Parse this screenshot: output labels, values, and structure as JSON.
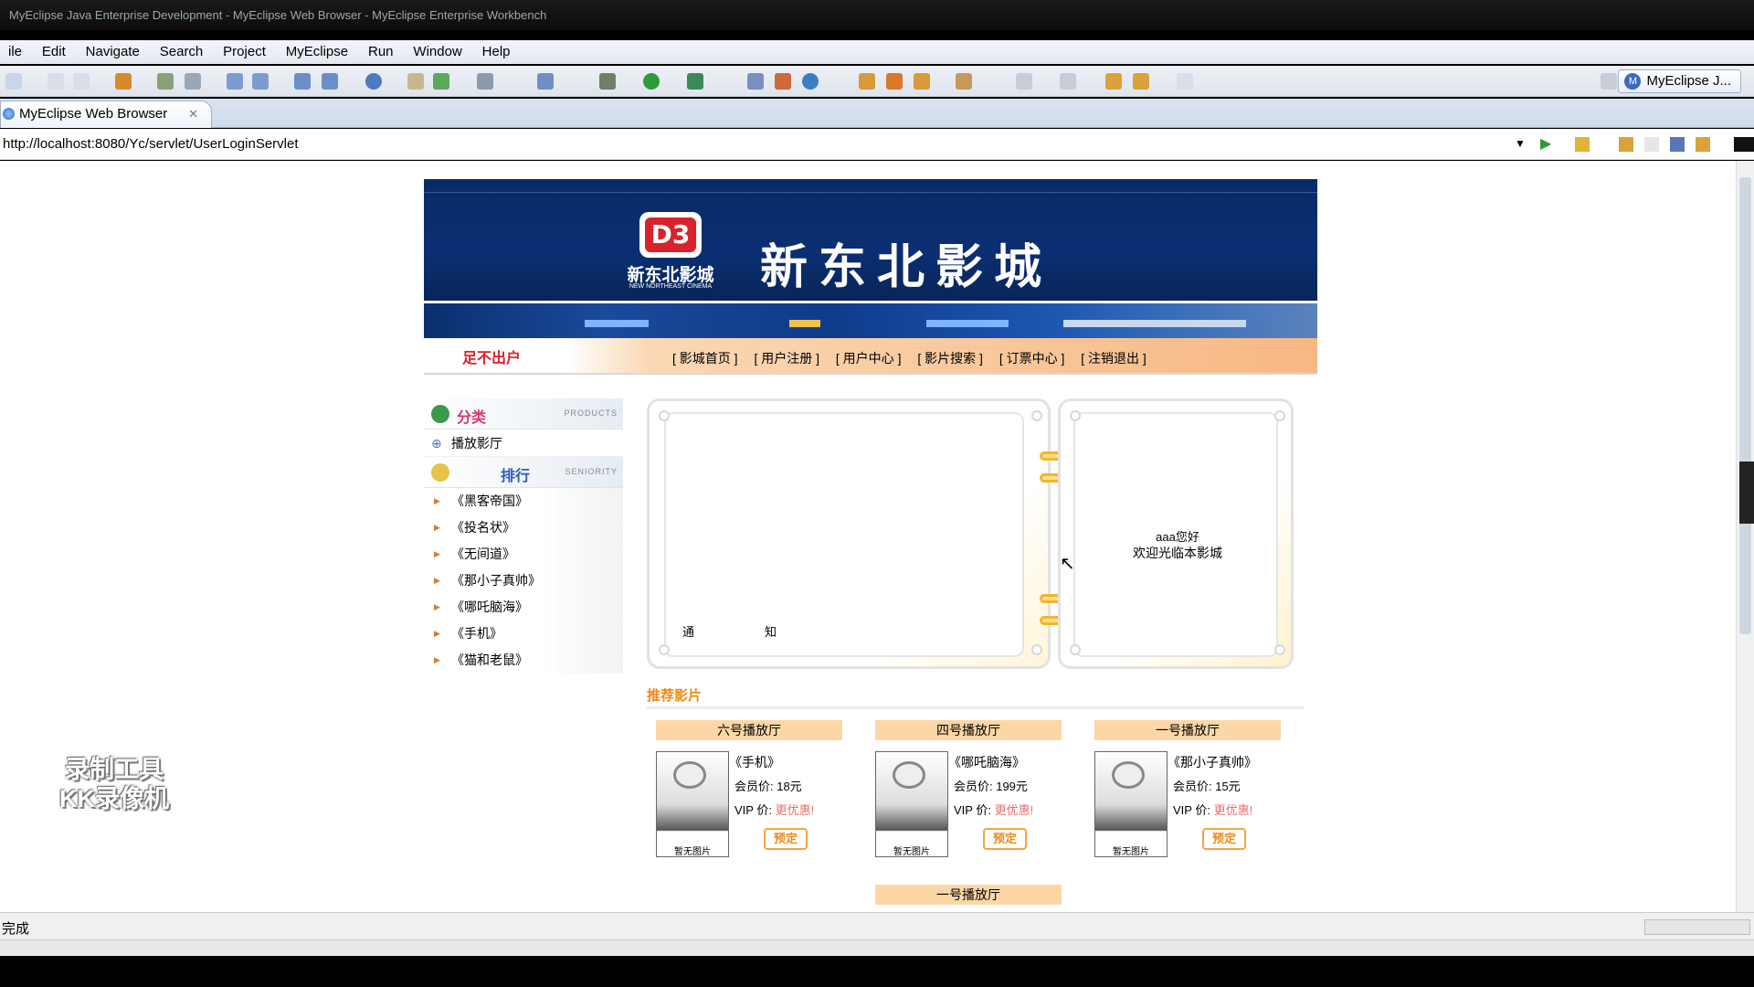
{
  "window": {
    "title": "MyEclipse Java Enterprise Development - MyEclipse Web Browser - MyEclipse Enterprise Workbench"
  },
  "menu": [
    "ile",
    "Edit",
    "Navigate",
    "Search",
    "Project",
    "MyEclipse",
    "Run",
    "Window",
    "Help"
  ],
  "perspective": {
    "icon": "myeclipse-logo-icon",
    "label": "MyEclipse J..."
  },
  "editor_tab": {
    "label": "MyEclipse Web Browser",
    "icon": "globe-icon",
    "close": "✕"
  },
  "address": {
    "url": "http://localhost:8080/Yc/servlet/UserLoginServlet"
  },
  "status": {
    "text": "完成"
  },
  "colors": {
    "banner": "#0b2f73",
    "accent": "#f28a13",
    "nav_gradient_end": "#f7b884"
  },
  "site": {
    "brand_short": "D3",
    "brand_name": "新东北影城",
    "brand_en": "NEW NORTHEAST CINEMA",
    "banner_title": "新东北影城",
    "slogan": "足不出户",
    "nav": [
      "[ 影城首页 ]",
      "[ 用户注册 ]",
      "[ 用户中心 ]",
      "[ 影片搜索 ]",
      "[ 订票中心 ]",
      "[ 注销退出 ]"
    ],
    "category": {
      "title": "分类",
      "en": "PRODUCTS",
      "items": [
        "播放影厅"
      ]
    },
    "ranking": {
      "title": "排行",
      "en": "SENIORITY",
      "items": [
        "《黑客帝国》",
        "《投名状》",
        "《无间道》",
        "《那小子真帅》",
        "《哪吒脑海》",
        "《手机》",
        "《猫和老鼠》"
      ]
    },
    "notice": {
      "left": "通",
      "right": "知"
    },
    "welcome": {
      "line1": "aaa您好",
      "line2": "欢迎光临本影城"
    },
    "recommend_title": "推荐影片",
    "cards": [
      {
        "hall": "六号播放厅",
        "name": "《手机》",
        "price": "会员价: 18元",
        "vip_label": "VIP 价:",
        "vip_value": "更优惠!",
        "book": "预定",
        "poster_text": "暂无图片"
      },
      {
        "hall": "四号播放厅",
        "name": "《哪吒脑海》",
        "price": "会员价: 199元",
        "vip_label": "VIP 价:",
        "vip_value": "更优惠!",
        "book": "预定",
        "poster_text": "暂无图片"
      },
      {
        "hall": "一号播放厅",
        "name": "《那小子真帅》",
        "price": "会员价: 15元",
        "vip_label": "VIP 价:",
        "vip_value": "更优惠!",
        "book": "预定",
        "poster_text": "暂无图片"
      }
    ],
    "next_hall": "一号播放厅"
  },
  "watermark": {
    "line1": "录制工具",
    "line2": "KK录像机"
  }
}
